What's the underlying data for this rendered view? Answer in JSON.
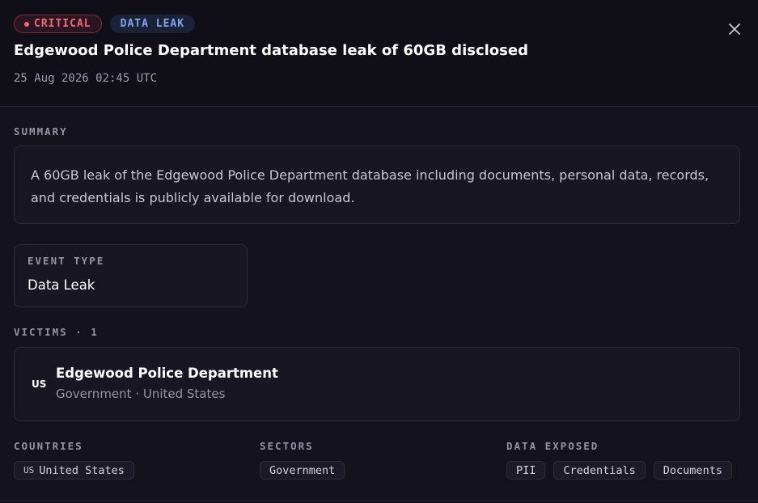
{
  "header": {
    "severity_badge": "CRITICAL",
    "type_badge": "DATA LEAK",
    "title": "Edgewood Police Department database leak of 60GB disclosed",
    "timestamp": "25 Aug 2026 02:45 UTC",
    "close_icon": "close-icon"
  },
  "summary": {
    "label": "SUMMARY",
    "text": "A 60GB leak of the Edgewood Police Department database including documents, personal data, records, and credentials is publicly available for download."
  },
  "event_type": {
    "label": "EVENT TYPE",
    "value": "Data Leak"
  },
  "victims": {
    "label": "VICTIMS · 1",
    "items": [
      {
        "flag": "US",
        "name": "Edgewood Police Department",
        "meta": "Government · United States"
      }
    ]
  },
  "countries": {
    "label": "COUNTRIES",
    "items": [
      {
        "code": "US",
        "name": "United States"
      }
    ]
  },
  "sectors": {
    "label": "SECTORS",
    "items": [
      "Government"
    ]
  },
  "data_exposed": {
    "label": "DATA EXPOSED",
    "items": [
      "PII",
      "Credentials",
      "Documents"
    ]
  },
  "colors": {
    "critical": "#f06a7c",
    "type_accent": "#7fa6ec",
    "background": "#14121c"
  }
}
